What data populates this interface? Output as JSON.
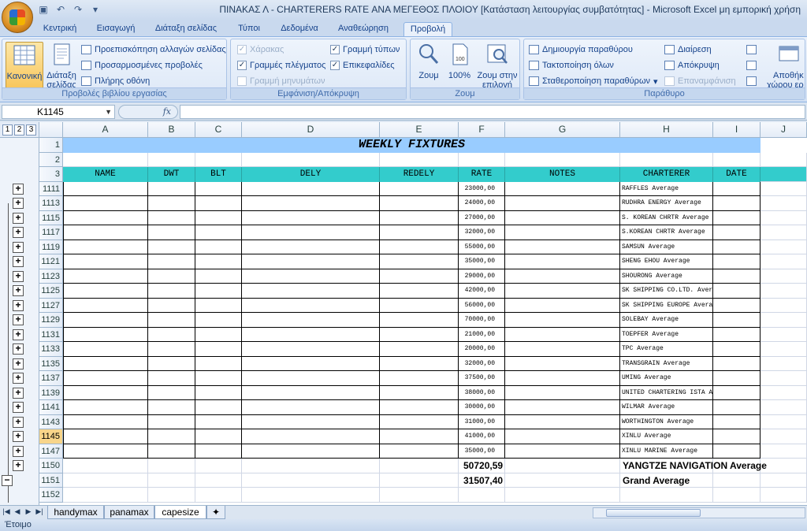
{
  "window": {
    "title": "ΠΙΝΑΚΑΣ Λ - CHARTERERS RATE ΑΝΑ ΜΕΓΕΘΟΣ ΠΛΟΙΟΥ  [Κατάσταση λειτουργίας συμβατότητας] - Microsoft Excel μη εμπορική χρήση"
  },
  "ribbon_tabs": [
    "Κεντρική",
    "Εισαγωγή",
    "Διάταξη σελίδας",
    "Τύποι",
    "Δεδομένα",
    "Αναθεώρηση",
    "Προβολή"
  ],
  "groups": {
    "workbook_views": {
      "label": "Προβολές βιβλίου εργασίας",
      "normal": "Κανονική",
      "page_layout_1": "Διάταξη",
      "page_layout_2": "σελίδας",
      "page_break": "Προεπισκόπηση αλλαγών σελίδας",
      "custom_views": "Προσαρμοσμένες προβολές",
      "full_screen": "Πλήρης οθόνη"
    },
    "show_hide": {
      "label": "Εμφάνιση/Απόκρυψη",
      "ruler": "Χάρακας",
      "gridlines": "Γραμμές πλέγματος",
      "message_bar": "Γραμμή μηνυμάτων",
      "formula_bar": "Γραμμή τύπων",
      "headings": "Επικεφαλίδες"
    },
    "zoom": {
      "label": "Ζουμ",
      "zoom": "Ζουμ",
      "zoom100": "100%",
      "zoom_sel_1": "Ζουμ στην",
      "zoom_sel_2": "επιλογή"
    },
    "window": {
      "label": "Παράθυρο",
      "new_window": "Δημιουργία παραθύρου",
      "arrange_all": "Τακτοποίηση όλων",
      "freeze_panes": "Σταθεροποίηση παραθύρων",
      "split": "Διαίρεση",
      "hide": "Απόκρυψη",
      "unhide": "Επαναμφάνιση",
      "save_ws_1": "Αποθήκ",
      "save_ws_2": "χώρου ερ"
    }
  },
  "formula_bar": {
    "name_box": "K1145",
    "fx": "fx",
    "formula": ""
  },
  "outline_levels": [
    "1",
    "2",
    "3"
  ],
  "columns": [
    "A",
    "B",
    "C",
    "D",
    "E",
    "F",
    "G",
    "H",
    "I",
    "J"
  ],
  "sheet": {
    "title": "WEEKLY FIXTURES",
    "headers": [
      "NAME",
      "DWT",
      "BLT",
      "DELY",
      "REDELY",
      "RATE",
      "NOTES",
      "CHARTERER",
      "DATE"
    ],
    "rows": [
      {
        "row": "1111",
        "rate": "23000,00",
        "charterer": "RAFFLES Average"
      },
      {
        "row": "1113",
        "rate": "24000,00",
        "charterer": "RUDHRA ENERGY Average"
      },
      {
        "row": "1115",
        "rate": "27000,00",
        "charterer": "S. KOREAN CHRTR Average"
      },
      {
        "row": "1117",
        "rate": "32000,00",
        "charterer": "S.KOREAN CHRTR Average"
      },
      {
        "row": "1119",
        "rate": "55000,00",
        "charterer": "SAMSUN Average"
      },
      {
        "row": "1121",
        "rate": "35000,00",
        "charterer": "SHENG EHOU Average"
      },
      {
        "row": "1123",
        "rate": "29000,00",
        "charterer": "SHOURONG Average"
      },
      {
        "row": "1125",
        "rate": "42000,00",
        "charterer": "SK SHIPPING CO.LTD. Average"
      },
      {
        "row": "1127",
        "rate": "56000,00",
        "charterer": "SK SHIPPING EUROPE Average"
      },
      {
        "row": "1129",
        "rate": "70000,00",
        "charterer": "SOLEBAY Average"
      },
      {
        "row": "1131",
        "rate": "21000,00",
        "charterer": "TOEPFER Average"
      },
      {
        "row": "1133",
        "rate": "20000,00",
        "charterer": "TPC Average"
      },
      {
        "row": "1135",
        "rate": "32000,00",
        "charterer": "TRANSGRAIN Average"
      },
      {
        "row": "1137",
        "rate": "37500,00",
        "charterer": "UMING Average"
      },
      {
        "row": "1139",
        "rate": "38000,00",
        "charterer": "UNITED CHARTERING ISTA Average"
      },
      {
        "row": "1141",
        "rate": "30000,00",
        "charterer": "WILMAR Average"
      },
      {
        "row": "1143",
        "rate": "31000,00",
        "charterer": "WORTHINGTON Average"
      },
      {
        "row": "1145",
        "rate": "41000,00",
        "charterer": "XINLU Average"
      },
      {
        "row": "1147",
        "rate": "35000,00",
        "charterer": "XINLU MARINE Average"
      }
    ],
    "summary": [
      {
        "row": "1150",
        "rate": "50720,59",
        "charterer": "YANGTZE NAVIGATION Average"
      },
      {
        "row": "1151",
        "rate": "31507,40",
        "charterer": "Grand Average"
      }
    ],
    "fixed_rows": [
      "1",
      "2",
      "3"
    ],
    "last_row": "1152",
    "selected_row": "1145"
  },
  "sheet_tabs": [
    "handymax",
    "panamax",
    "capesize"
  ],
  "active_sheet": "capesize",
  "status": "Έτοιμο"
}
